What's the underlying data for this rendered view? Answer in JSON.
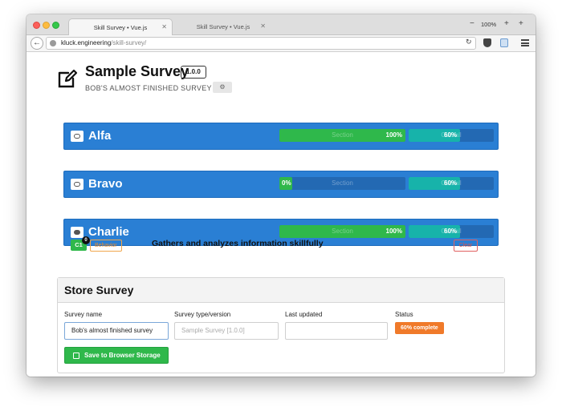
{
  "browser": {
    "tabs": [
      {
        "label": "Skill Survey • Vue.js",
        "active": true
      },
      {
        "label": "Skill Survey • Vue.js",
        "active": false
      }
    ],
    "zoom": "100%",
    "url_host": "kluck.engineering",
    "url_path": "/skill-survey/",
    "window_minus": "−",
    "window_plus": "+",
    "new_tab": "+"
  },
  "header": {
    "title": "Sample Survey",
    "version": "1.0.0",
    "subtitle": "BOB'S ALMOST FINISHED SURVEY",
    "subtitle_button_icon": "gear-icon"
  },
  "sections": [
    {
      "name": "Alfa",
      "expanded": false,
      "section_label": "Section",
      "section_value": "100%",
      "section_progress": 1.0,
      "overall_label": "Overall",
      "overall_value": "60%",
      "overall_progress": 0.6
    },
    {
      "name": "Bravo",
      "expanded": false,
      "section_label": "Section",
      "section_value": "0%",
      "section_progress": 0.0,
      "overall_label": "Overall",
      "overall_value": "60%",
      "overall_progress": 0.6
    },
    {
      "name": "Charlie",
      "expanded": true,
      "section_label": "Section",
      "section_value": "100%",
      "section_progress": 1.0,
      "overall_label": "Overall",
      "overall_value": "60%",
      "overall_progress": 0.6
    }
  ],
  "skill": {
    "code": "C1",
    "badge": "0",
    "category": "Behavior",
    "text": "Gathers and analyzes information skillfully",
    "clear_label": "Clear"
  },
  "store": {
    "title": "Store Survey",
    "name_label": "Survey name",
    "name_value": "Bob's almost finished survey",
    "type_label": "Survey type/version",
    "type_placeholder": "Sample Survey [1.0.0]",
    "updated_label": "Last updated",
    "updated_value": "",
    "status_label": "Status",
    "status_value": "60% complete",
    "save_label": "Save to Browser Storage"
  },
  "colors": {
    "section_bg": "#2a7fd4",
    "progress_green": "#2fb84b",
    "progress_teal": "#17b3aa",
    "status_orange": "#f07a2a"
  }
}
